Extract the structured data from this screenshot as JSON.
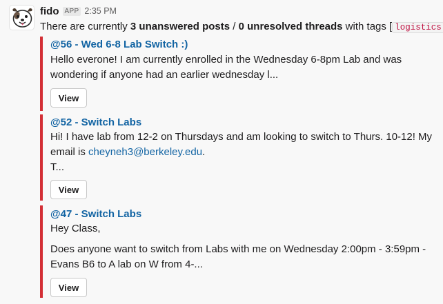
{
  "message": {
    "username": "fido",
    "app_badge": "APP",
    "timestamp": "2:35 PM",
    "summary": {
      "prefix": "There are currently ",
      "unanswered": "3 unanswered posts",
      "separator": " / ",
      "unresolved": "0 unresolved threads",
      "tags_text": " with tags [",
      "tag": "logistics",
      "suffix": "]"
    }
  },
  "accent_color": "#d32f35",
  "link_color": "#1264a3",
  "posts": [
    {
      "title": "@56 - Wed 6-8 Lab Switch :)",
      "body_line1": "Hello everone! I am currently enrolled in the Wednesday 6-8pm Lab and was",
      "body_line2": "wondering if anyone had an earlier wednesday l...",
      "button": "View"
    },
    {
      "title": "@52 - Switch Labs",
      "body_line1": "Hi! I have lab from 12-2 on Thursdays and am looking to switch to Thurs. 10-12! My",
      "body_line2_prefix": "email is ",
      "email": "cheyneh3@berkeley.edu",
      "body_line2_suffix": ".",
      "body_line3": "T...",
      "button": "View"
    },
    {
      "title": "@47 - Switch Labs",
      "body_line1": "Hey Class,",
      "body_line2": "Does anyone want to switch from Labs with me on Wednesday  2:00pm - 3:59pm -",
      "body_line3": "Evans B6 to A lab on W from 4-...",
      "button": "View"
    }
  ]
}
